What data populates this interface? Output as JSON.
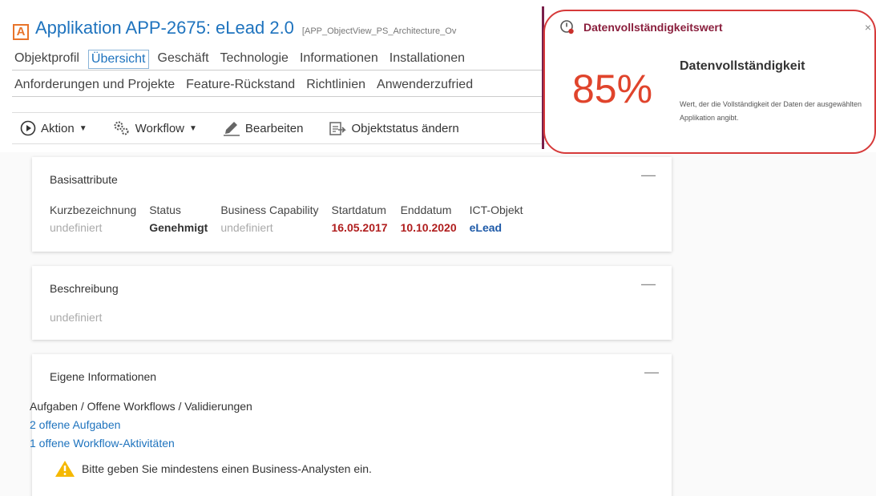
{
  "header": {
    "badge": "A",
    "title": "Applikation APP-2675: eLead 2.0",
    "code": "[APP_ObjectView_PS_Architecture_Ov"
  },
  "tabs_row1": [
    "Objektprofil",
    "Übersicht",
    "Geschäft",
    "Technologie",
    "Informationen",
    "Installationen"
  ],
  "tabs_row2": [
    "Anforderungen und Projekte",
    "Feature-Rückstand",
    "Richtlinien",
    "Anwenderzufried"
  ],
  "toolbar": {
    "action": "Aktion",
    "workflow": "Workflow",
    "edit": "Bearbeiten",
    "status": "Objektstatus ändern"
  },
  "basis": {
    "title": "Basisattribute",
    "attrs": [
      {
        "label": "Kurzbezeichnung",
        "value": "undefiniert"
      },
      {
        "label": "Status",
        "value": "Genehmigt"
      },
      {
        "label": "Business Capability",
        "value": "undefiniert"
      },
      {
        "label": "Startdatum",
        "value": "16.05.2017"
      },
      {
        "label": "Enddatum",
        "value": "10.10.2020"
      },
      {
        "label": "ICT-Objekt",
        "value": "eLead"
      }
    ]
  },
  "desc": {
    "title": "Beschreibung",
    "value": "undefiniert"
  },
  "own": {
    "title": "Eigene Informationen",
    "heading": "Aufgaben / Offene Workflows / Validierungen",
    "tasks": "2 offene Aufgaben",
    "workflows": "1 offene Workflow-Aktivitäten",
    "warning": "Bitte geben Sie mindestens einen Business-Analysten ein."
  },
  "popover": {
    "title": "Datenvollständigkeitswert",
    "close": "×",
    "percent": "85%",
    "heading": "Datenvollständigkeit",
    "description": "Wert, der die Vollständigkeit der Daten der ausgewählten Applikation angibt."
  },
  "colors": {
    "accent": "#1e73be",
    "percent": "#e0442c",
    "highlight_ring": "#d63a3a"
  }
}
